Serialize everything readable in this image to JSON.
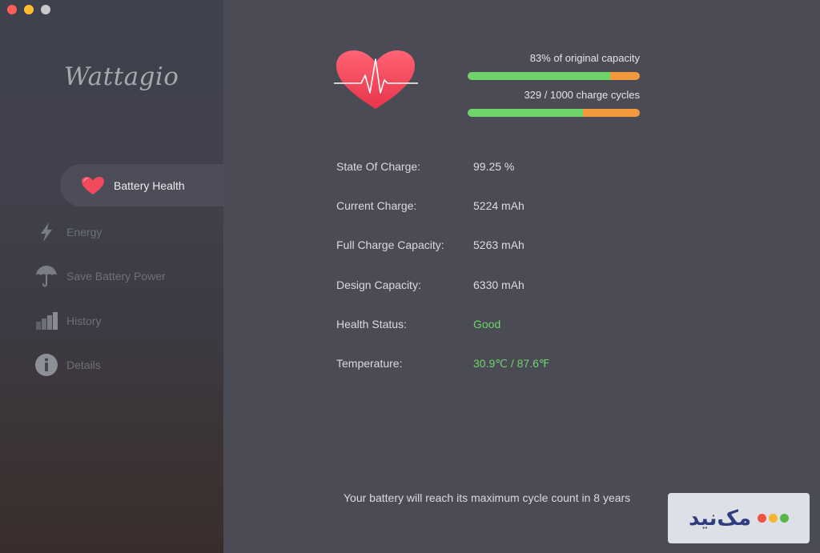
{
  "app": {
    "name": "Wattagio"
  },
  "colors": {
    "accent_green": "#6fd46a",
    "accent_orange": "#f39a3c",
    "heart_red": "#f2495d"
  },
  "sidebar": {
    "active": {
      "label": "Battery Health",
      "icon": "heart-icon"
    },
    "items": [
      {
        "label": "Energy",
        "icon": "lightning-icon"
      },
      {
        "label": "Save Battery Power",
        "icon": "umbrella-icon"
      },
      {
        "label": "History",
        "icon": "bar-chart-icon"
      },
      {
        "label": "Details",
        "icon": "info-icon"
      }
    ]
  },
  "health": {
    "capacity_label": "83% of original capacity",
    "capacity_fraction": 0.83,
    "cycles_label": "329 / 1000 charge cycles",
    "cycles_fraction": 0.67
  },
  "stats": [
    {
      "label": "State Of Charge:",
      "value": "99.25 %"
    },
    {
      "label": "Current Charge:",
      "value": "5224 mAh"
    },
    {
      "label": "Full Charge Capacity:",
      "value": "5263 mAh"
    },
    {
      "label": "Design Capacity:",
      "value": "6330 mAh"
    },
    {
      "label": "Health Status:",
      "value": "Good"
    },
    {
      "label": "Temperature:",
      "value": "30.9℃ / 87.6℉"
    }
  ],
  "footer": {
    "message": "Your battery will reach its maximum cycle count in 8 years"
  },
  "watermark": {
    "text": "مک‌نید"
  }
}
